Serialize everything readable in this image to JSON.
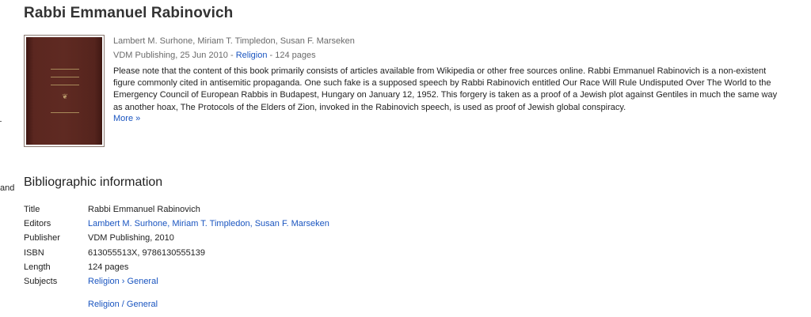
{
  "book": {
    "title": "Rabbi Emmanuel Rabinovich",
    "authors": "Lambert M. Surhone, Miriam T. Timpledon, Susan F. Marseken",
    "publisher_date": "VDM Publishing, 25 Jun 2010",
    "separator1": " - ",
    "category": "Religion",
    "separator2": " - ",
    "pages": "124 pages",
    "description": "Please note that the content of this book primarily consists of articles available from Wikipedia or other free sources online. Rabbi Emmanuel Rabinovich is a non-existent figure commonly cited in antisemitic propaganda. One such fake is a supposed speech by Rabbi Rabinovich entitled Our Race Will Rule Undisputed Over The World to the Emergency Council of European Rabbis in Budapest, Hungary on January 12, 1952. This forgery is taken as a proof of a Jewish plot against Gentiles in much the same way as another hoax, The Protocols of the Elders of Zion, invoked in the Rabinovich speech, is used as proof of Jewish global conspiracy.",
    "more_label": "More »"
  },
  "side_text": "and",
  "bib": {
    "heading": "Bibliographic information",
    "rows": [
      {
        "label": "Title",
        "value": "Rabbi Emmanuel Rabinovich"
      },
      {
        "label": "Editors",
        "value": "Lambert M. Surhone, Miriam T. Timpledon, Susan F. Marseken"
      },
      {
        "label": "Publisher",
        "value": "VDM Publishing, 2010"
      },
      {
        "label": "ISBN",
        "value": "613055513X, 9786130555139"
      },
      {
        "label": "Length",
        "value": "124 pages"
      },
      {
        "label": "Subjects",
        "value": "Religion › General"
      }
    ],
    "extra_link": "Religion / General"
  },
  "colors": {
    "link": "#1a55c0",
    "cover": "#5b2720",
    "meta_text": "#6a6a6a"
  }
}
